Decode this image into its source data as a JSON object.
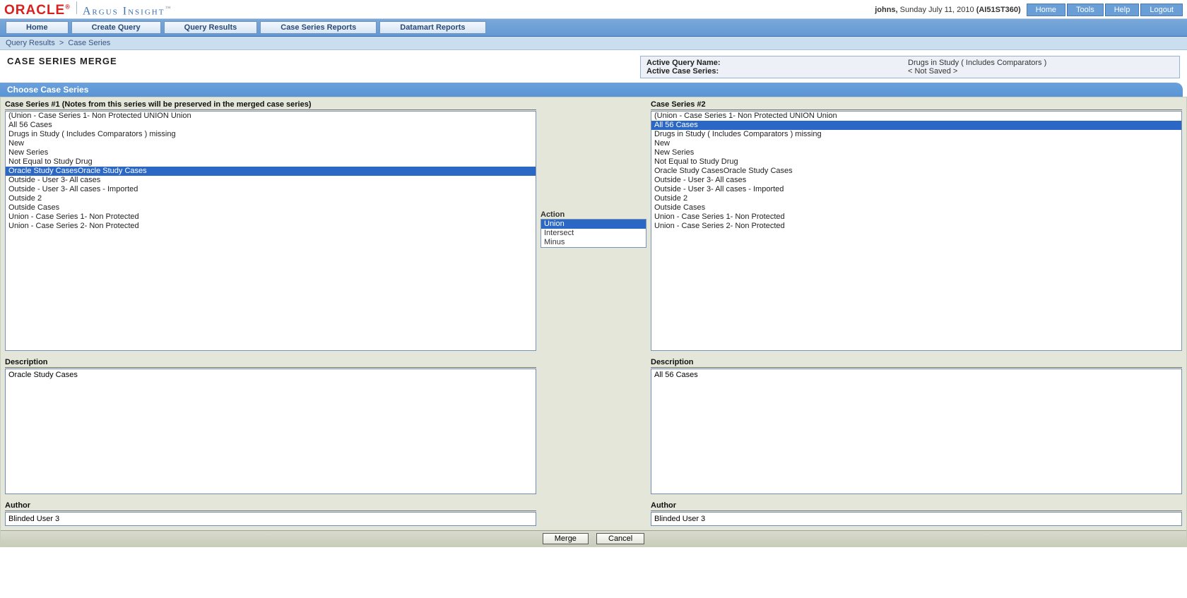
{
  "header": {
    "oracle_logo": "ORACLE",
    "product": "Argus Insight",
    "tm": "™",
    "user": "johns,",
    "date": "Sunday July 11, 2010",
    "context": "(AI51ST360)",
    "links": [
      "Home",
      "Tools",
      "Help",
      "Logout"
    ]
  },
  "menu": [
    "Home",
    "Create Query",
    "Query Results",
    "Case Series Reports",
    "Datamart Reports"
  ],
  "breadcrumb": {
    "part1": "Query Results",
    "sep": ">",
    "part2": "Case Series"
  },
  "page_title": "CASE SERIES MERGE",
  "info": {
    "label1": "Active Query Name:",
    "val1": "Drugs in Study ( Includes Comparators )",
    "label2": "Active Case Series:",
    "val2": "< Not Saved >"
  },
  "section_header": "Choose Case Series",
  "left": {
    "title": "Case Series #1 (Notes from this series will be preserved in the merged case series)",
    "items": [
      "(Union - Case Series 1- Non Protected UNION Union",
      "All 56 Cases",
      "Drugs in Study ( Includes Comparators ) missing",
      "New",
      "New Series",
      "Not Equal to Study Drug",
      "Oracle Study CasesOracle Study Cases",
      "Outside - User 3- All cases",
      "Outside - User 3- All cases - Imported",
      "Outside 2",
      "Outside Cases",
      "Union - Case Series 1- Non Protected",
      "Union - Case Series 2- Non Protected"
    ],
    "selected_index": 6,
    "desc_label": "Description",
    "desc_value": "Oracle Study Cases",
    "author_label": "Author",
    "author_value": "Blinded User 3"
  },
  "action": {
    "title": "Action",
    "items": [
      "Union",
      "Intersect",
      "Minus"
    ],
    "selected_index": 0
  },
  "right": {
    "title": "Case Series #2",
    "items": [
      "(Union - Case Series 1- Non Protected UNION Union",
      "All 56 Cases",
      "Drugs in Study ( Includes Comparators ) missing",
      "New",
      "New Series",
      "Not Equal to Study Drug",
      "Oracle Study CasesOracle Study Cases",
      "Outside - User 3- All cases",
      "Outside - User 3- All cases - Imported",
      "Outside 2",
      "Outside Cases",
      "Union - Case Series 1- Non Protected",
      "Union - Case Series 2- Non Protected"
    ],
    "selected_index": 1,
    "desc_label": "Description",
    "desc_value": "All 56 Cases",
    "author_label": "Author",
    "author_value": "Blinded User 3"
  },
  "footer": {
    "merge": "Merge",
    "cancel": "Cancel"
  }
}
